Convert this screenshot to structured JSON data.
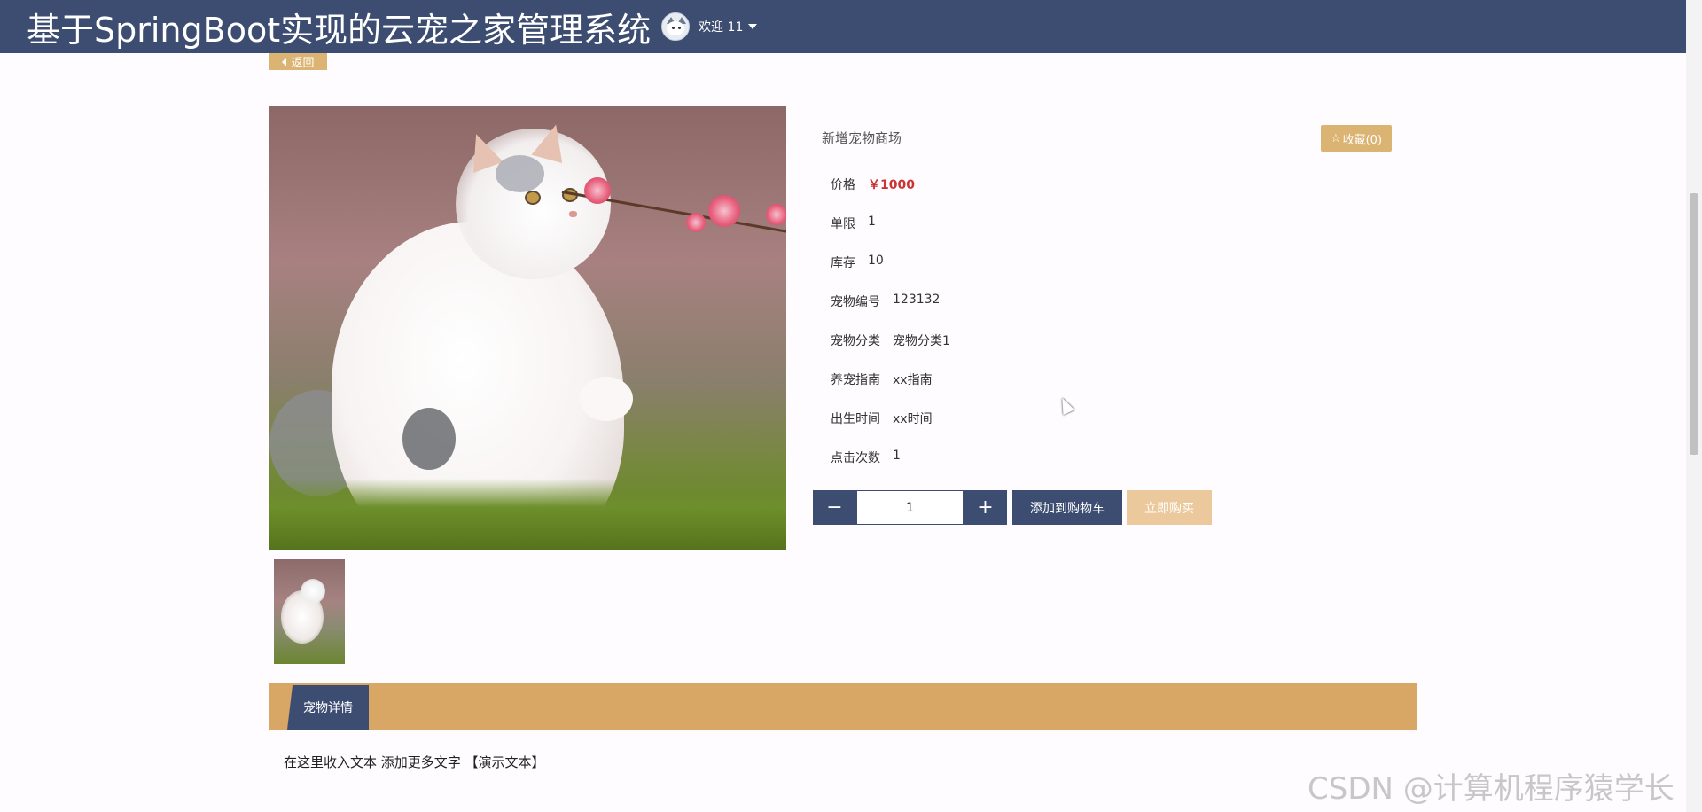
{
  "header": {
    "title": "基于SpringBoot实现的云宠之家管理系统",
    "welcome": "欢迎 11",
    "avatar_icon": "cat-avatar-icon"
  },
  "back_button": {
    "label": "返回"
  },
  "product": {
    "title": "新增宠物商场",
    "favorite_label": "收藏(0)",
    "price": {
      "label": "价格",
      "value": "￥1000"
    },
    "limit": {
      "label": "单限",
      "value": "1"
    },
    "stock": {
      "label": "库存",
      "value": "10"
    },
    "pet_no": {
      "label": "宠物编号",
      "value": "123132"
    },
    "category": {
      "label": "宠物分类",
      "value": "宠物分类1"
    },
    "guide": {
      "label": "养宠指南",
      "value": "xx指南"
    },
    "birth": {
      "label": "出生时间",
      "value": "xx时间"
    },
    "clicks": {
      "label": "点击次数",
      "value": "1"
    }
  },
  "purchase": {
    "minus": "−",
    "plus": "+",
    "quantity": "1",
    "add_to_cart": "添加到购物车",
    "buy_now": "立即购买"
  },
  "tabs": {
    "detail": "宠物详情"
  },
  "detail_text": "在这里收入文本 添加更多文字 【演示文本】",
  "watermark": "CSDN @计算机程序猿学长",
  "colors": {
    "primary": "#3d4d72",
    "accent": "#dbb474",
    "price": "#cc3333",
    "tab_bar": "#d8a765"
  }
}
